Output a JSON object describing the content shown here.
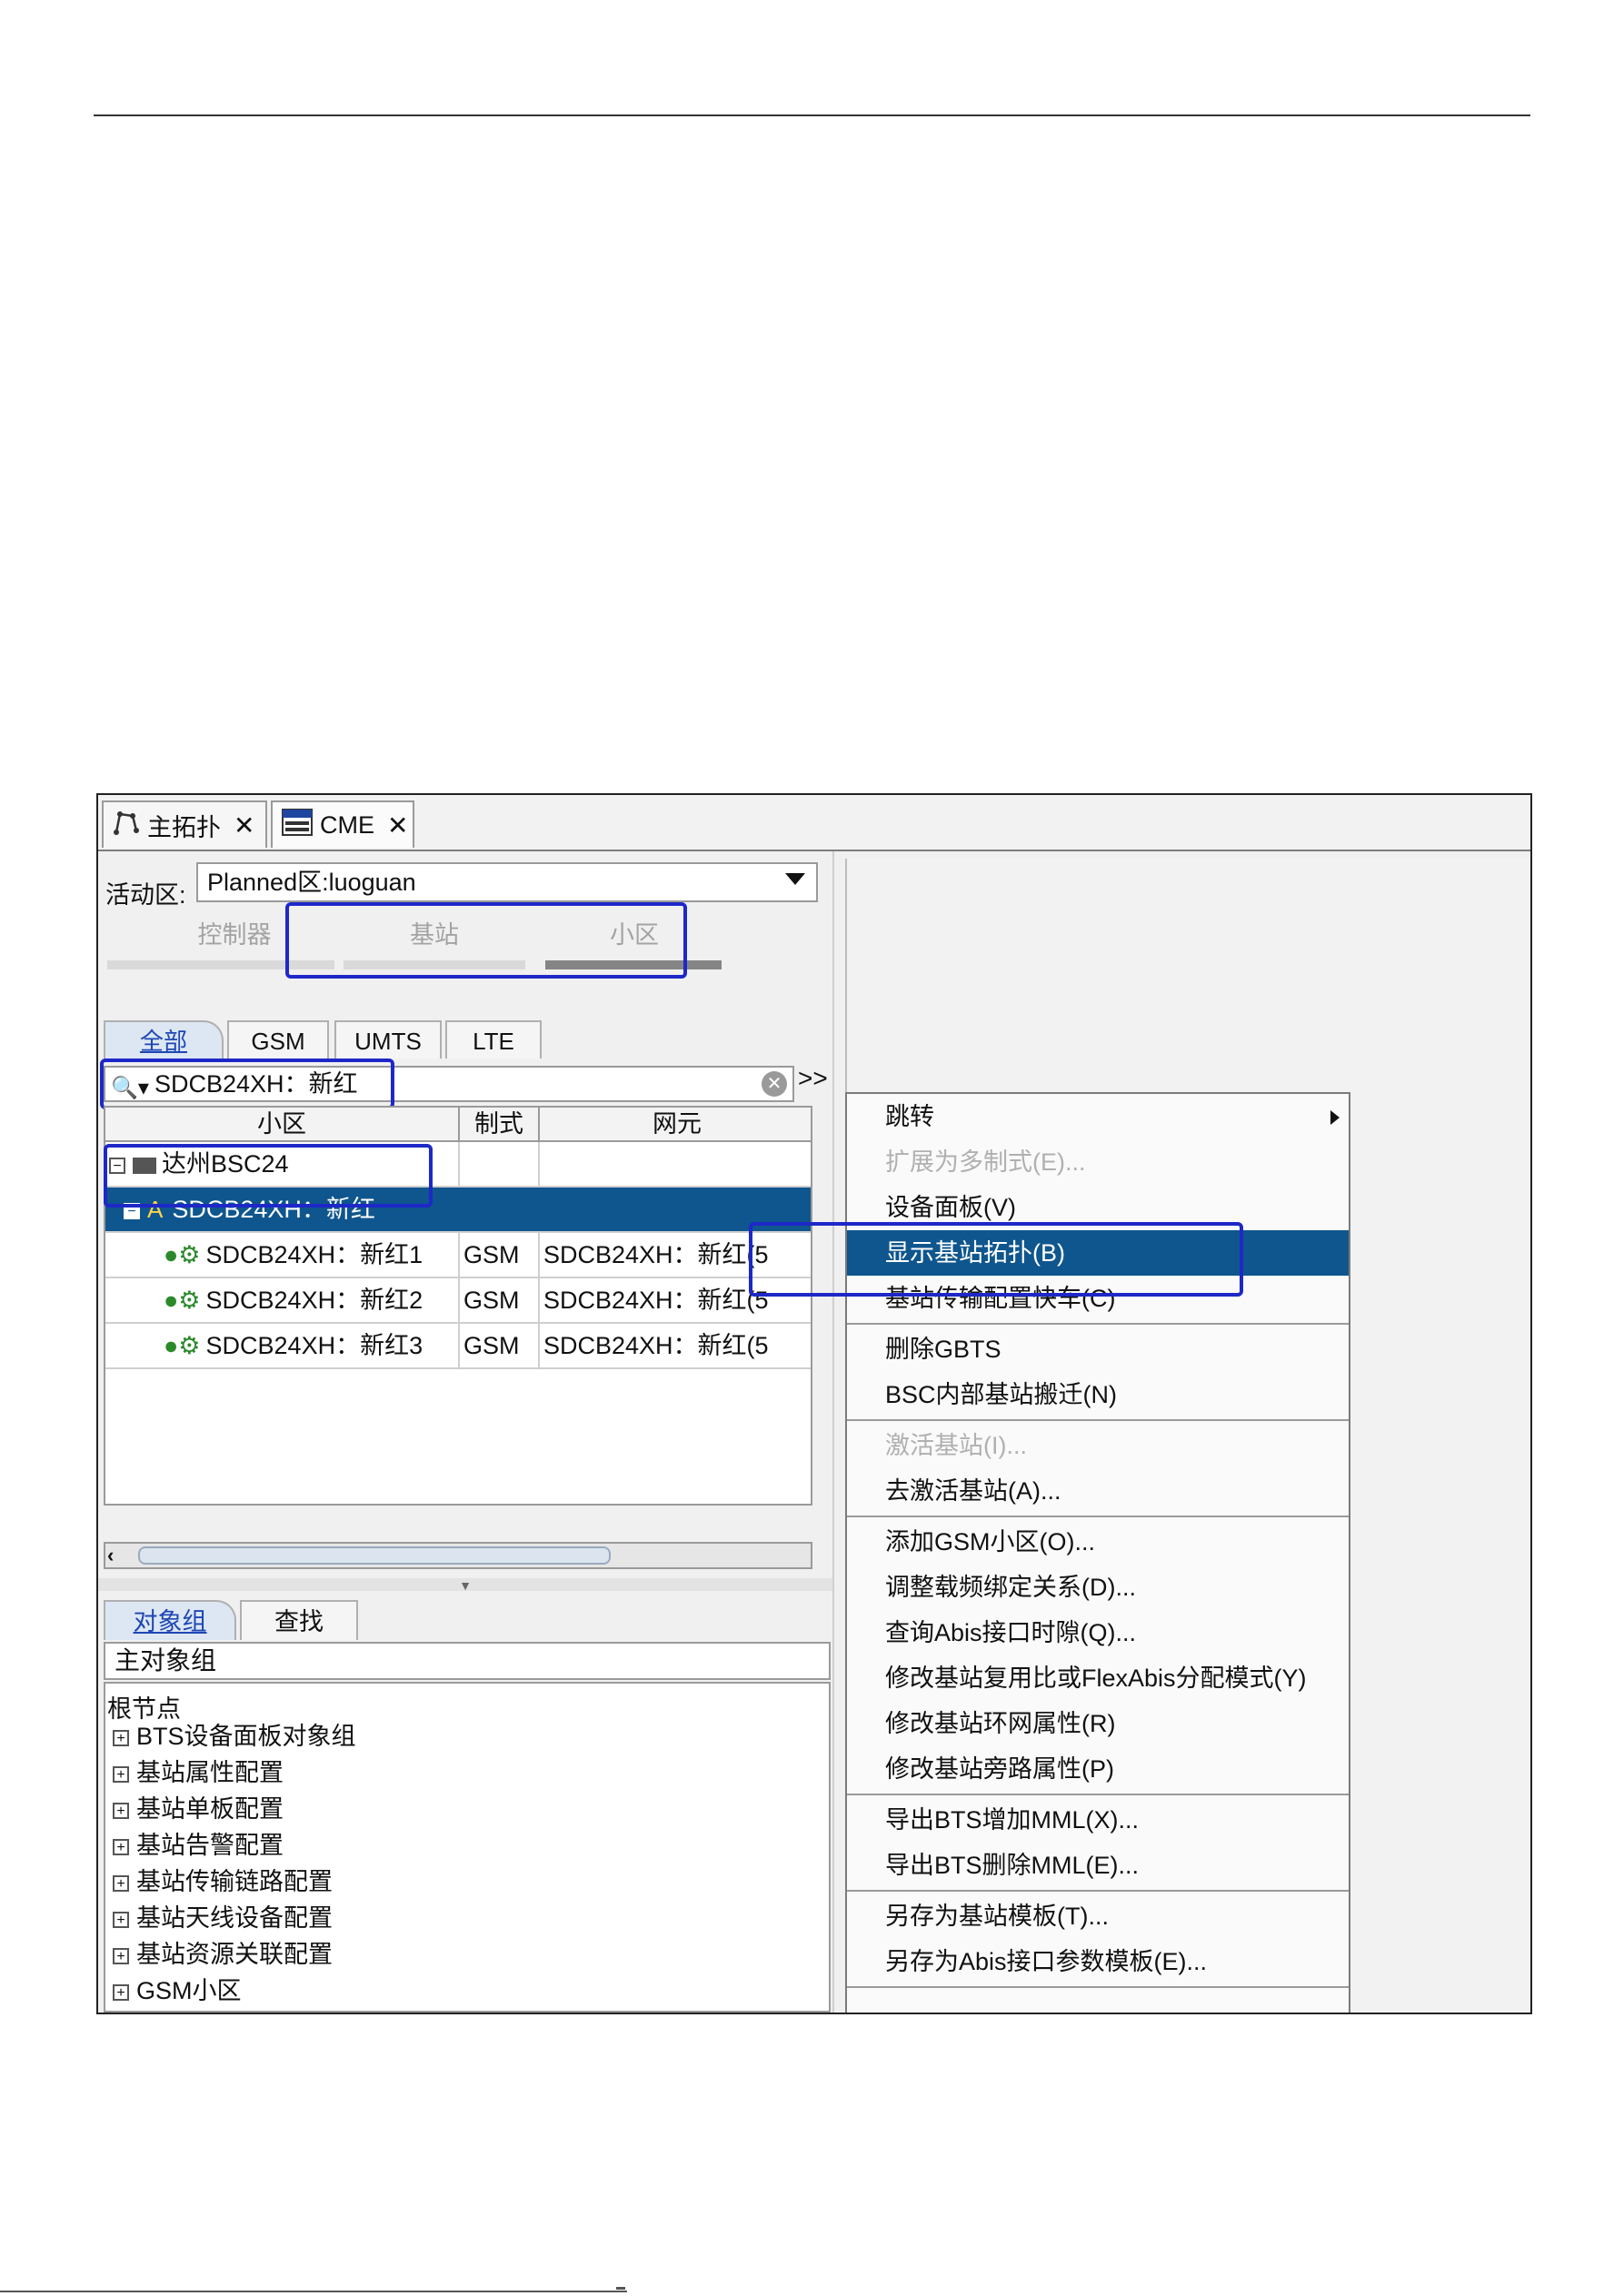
{
  "tabs": [
    {
      "label": "主拓扑",
      "icon": "topology-icon"
    },
    {
      "label": "CME",
      "icon": "cme-icon"
    }
  ],
  "active_area": {
    "label": "活动区:",
    "value": "Planned区:luoguan"
  },
  "segments": [
    "控制器",
    "基站",
    "小区"
  ],
  "subtabs": [
    "全部",
    "GSM",
    "UMTS",
    "LTE"
  ],
  "search": {
    "value": "SDCB24XH：新红",
    "more": ">>"
  },
  "grid": {
    "headers": [
      "小区",
      "制式",
      "网元"
    ],
    "rows": [
      {
        "name": "达州BSC24",
        "type": "",
        "ne": ""
      },
      {
        "name": "SDCB24XH：新红",
        "type": "",
        "ne": ""
      },
      {
        "name": "SDCB24XH：新红1",
        "type": "GSM",
        "ne": "SDCB24XH：新红(5"
      },
      {
        "name": "SDCB24XH：新红2",
        "type": "GSM",
        "ne": "SDCB24XH：新红(5"
      },
      {
        "name": "SDCB24XH：新红3",
        "type": "GSM",
        "ne": "SDCB24XH：新红(5"
      }
    ]
  },
  "lower": {
    "tabs": [
      "对象组",
      "查找"
    ],
    "group": "主对象组",
    "root": "根节点",
    "tree": [
      "BTS设备面板对象组",
      "基站属性配置",
      "基站单板配置",
      "基站告警配置",
      "基站传输链路配置",
      "基站天线设备配置",
      "基站资源关联配置",
      "GSM小区"
    ]
  },
  "menu": {
    "items": [
      {
        "label": "跳转",
        "disabled": false
      },
      {
        "label": "扩展为多制式(E)...",
        "disabled": true
      },
      {
        "label": "设备面板(V)",
        "disabled": false
      },
      {
        "label": "显示基站拓扑(B)",
        "disabled": false
      },
      {
        "label": "基站传输配置快车(C)",
        "disabled": false
      },
      {
        "label": "删除GBTS",
        "disabled": false
      },
      {
        "label": "BSC内部基站搬迁(N)",
        "disabled": false
      },
      {
        "label": "激活基站(I)...",
        "disabled": true
      },
      {
        "label": "去激活基站(A)...",
        "disabled": false
      },
      {
        "label": "添加GSM小区(O)...",
        "disabled": false
      },
      {
        "label": "调整载频绑定关系(D)...",
        "disabled": false
      },
      {
        "label": "查询Abis接口时隙(Q)...",
        "disabled": false
      },
      {
        "label": "修改基站复用比或FlexAbis分配模式(Y)",
        "disabled": false
      },
      {
        "label": "修改基站环网属性(R)",
        "disabled": false
      },
      {
        "label": "修改基站旁路属性(P)",
        "disabled": false
      },
      {
        "label": "导出BTS增加MML(X)...",
        "disabled": false
      },
      {
        "label": "导出BTS删除MML(E)...",
        "disabled": false
      },
      {
        "label": "另存为基站模板(T)...",
        "disabled": false
      },
      {
        "label": "另存为Abis接口参数模板(E)...",
        "disabled": false
      }
    ],
    "selected_index": 3
  },
  "colors": {
    "highlight_box": "#1e28c8",
    "selection": "#0f568e"
  }
}
